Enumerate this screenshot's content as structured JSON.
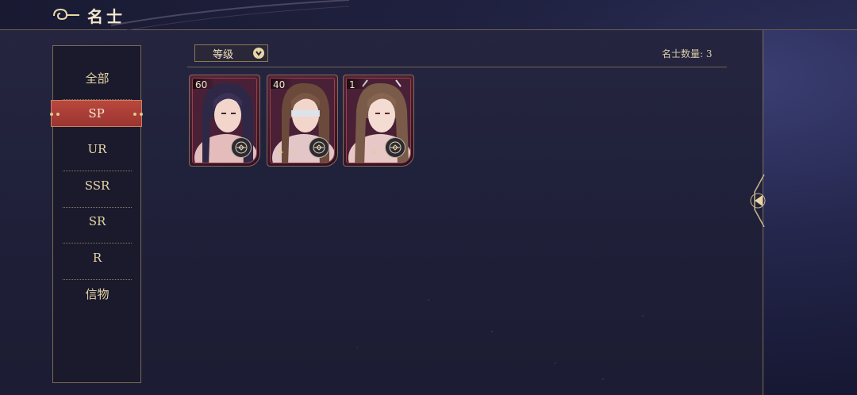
{
  "header": {
    "title": "名士"
  },
  "sidebar": {
    "items": [
      {
        "label": "全部"
      },
      {
        "label": "SP"
      },
      {
        "label": "UR"
      },
      {
        "label": "SSR"
      },
      {
        "label": "SR"
      },
      {
        "label": "R"
      },
      {
        "label": "信物"
      }
    ],
    "active_index": 1
  },
  "filter": {
    "sort_label": "等级"
  },
  "count": {
    "text": "名士数量: 3"
  },
  "cards": [
    {
      "level": "60",
      "hair": "dark-purple",
      "icon": "compass-badge-icon"
    },
    {
      "level": "40",
      "hair": "brown-blindfold",
      "icon": "compass-badge-icon"
    },
    {
      "level": "1",
      "hair": "long-brown",
      "icon": "compass-badge-icon"
    }
  ],
  "colors": {
    "accent": "#b9483e",
    "gold": "#e8d6a8",
    "panel": "#20213a"
  }
}
